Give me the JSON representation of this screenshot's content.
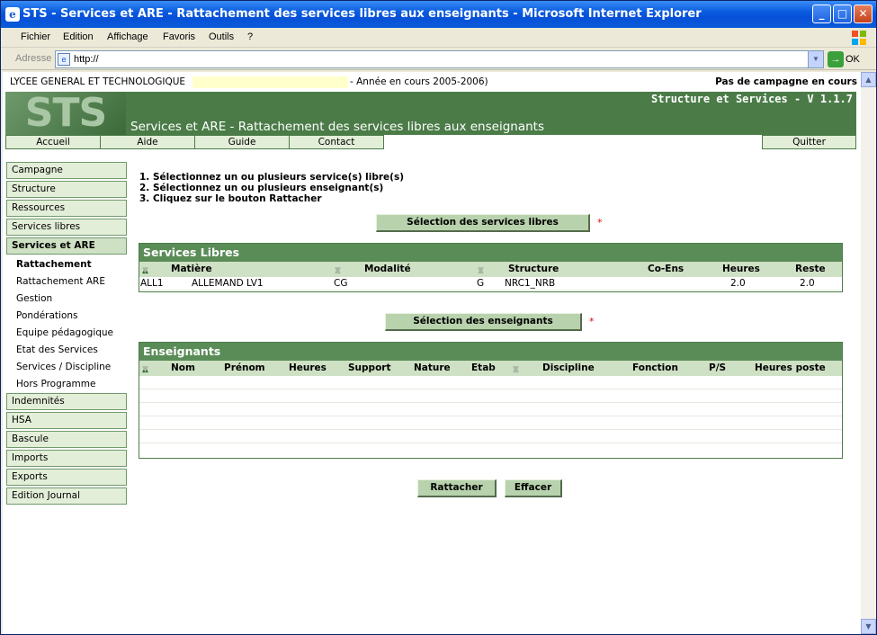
{
  "window": {
    "title": "STS - Services et ARE - Rattachement des services libres aux enseignants - Microsoft Internet Explorer"
  },
  "menu": [
    "Fichier",
    "Edition",
    "Affichage",
    "Favoris",
    "Outils",
    "?"
  ],
  "address": {
    "label": "Adresse",
    "value": "http://",
    "go": "OK"
  },
  "header": {
    "school": "LYCEE GENERAL ET TECHNOLOGIQUE",
    "year": "- Année en cours 2005-2006)",
    "campaign": "Pas de campagne en cours",
    "logo": "STS",
    "version": "Structure et Services - V 1.1.7",
    "heading": "Services et ARE - Rattachement des services libres aux enseignants"
  },
  "nav": {
    "accueil": "Accueil",
    "aide": "Aide",
    "guide": "Guide",
    "contact": "Contact",
    "quitter": "Quitter"
  },
  "sidebar": {
    "items": [
      "Campagne",
      "Structure",
      "Ressources",
      "Services libres",
      "Services et ARE"
    ],
    "subitems": [
      "Rattachement",
      "Rattachement ARE",
      "Gestion",
      "Pondérations",
      "Equipe pédagogique",
      "Etat des Services",
      "Services / Discipline",
      "Hors Programme"
    ],
    "items_after": [
      "Indemnités",
      "HSA",
      "Bascule",
      "Imports",
      "Exports",
      "Edition Journal"
    ]
  },
  "instructions": [
    "1. Sélectionnez un ou plusieurs service(s) libre(s)",
    "2. Sélectionnez un ou plusieurs enseignant(s)",
    "3. Cliquez sur le bouton Rattacher"
  ],
  "buttons": {
    "select_services": "Sélection des services libres",
    "select_teachers": "Sélection des enseignants",
    "attach": "Rattacher",
    "clear": "Effacer",
    "required_mark": "*"
  },
  "services_panel": {
    "title": "Services Libres",
    "columns": [
      "Matière",
      "Modalité",
      "Structure",
      "Co-Ens",
      "Heures",
      "Reste"
    ],
    "rows": [
      {
        "code": "ALL1",
        "matiere": "ALLEMAND LV1",
        "modalite": "CG",
        "type": "G",
        "structure": "NRC1_NRB",
        "coens": "",
        "heures": "2.0",
        "reste": "2.0"
      }
    ]
  },
  "teachers_panel": {
    "title": "Enseignants",
    "columns": [
      "Nom",
      "Prénom",
      "Heures",
      "Support",
      "Nature",
      "Etab",
      "Discipline",
      "Fonction",
      "P/S",
      "Heures poste"
    ]
  }
}
